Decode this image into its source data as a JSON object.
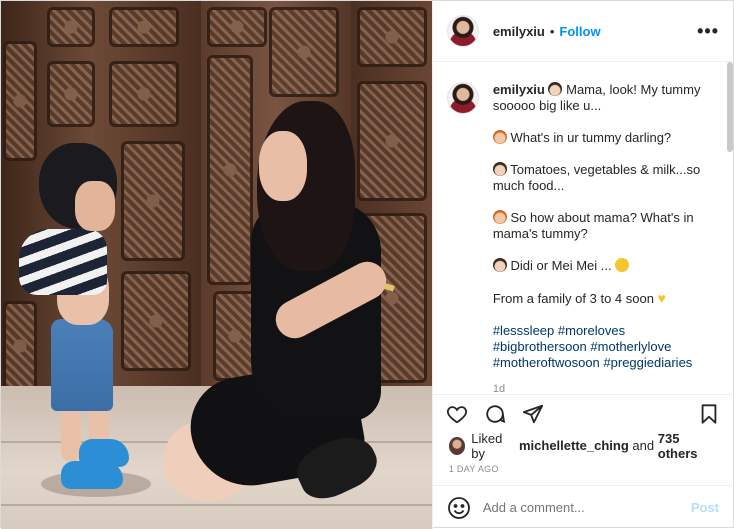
{
  "post": {
    "username": "emilyxiu",
    "separator": "•",
    "follow_label": "Follow",
    "more_icon": "more-horizontal-icon",
    "more_label": "•••"
  },
  "caption": {
    "username": "emilyxiu",
    "lines": [
      "Mama, look! My tummy sooooo big like u...",
      "What's in ur tummy darling?",
      "Tomatoes, vegetables & milk...so much food...",
      "So how about mama? What's in mama's tummy?",
      "Didi or Mei Mei ...",
      "From a family of 3 to 4 soon"
    ],
    "hashtags": [
      "#lesssleep",
      "#moreloves",
      "#bigbrothersoon",
      "#motherlylove",
      "#motheroftwosoon",
      "#preggiediaries"
    ],
    "age": "1d"
  },
  "actions": {
    "like_icon": "heart-icon",
    "comment_icon": "comment-icon",
    "share_icon": "share-icon",
    "save_icon": "bookmark-icon"
  },
  "likes": {
    "prefix": "Liked by",
    "user": "michellette_ching",
    "conj": "and",
    "others": "735 others"
  },
  "timestamp": "1 DAY AGO",
  "comment_box": {
    "placeholder": "Add a comment...",
    "post_label": "Post",
    "emoji_icon": "smiley-icon"
  },
  "colors": {
    "accent": "#0095f6",
    "post_disabled": "#b2dffc",
    "hashtag": "#00376b"
  }
}
